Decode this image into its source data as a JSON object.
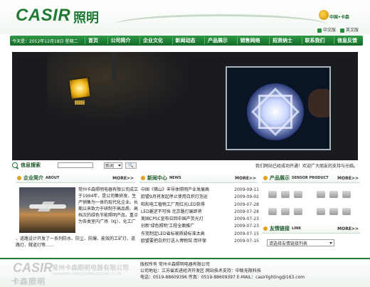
{
  "header": {
    "logo_en": "CASIR",
    "logo_cn": "照明",
    "brand_badge_text": "中国•卡森",
    "lang_cn": "中文版",
    "lang_en": "英文版"
  },
  "nav": {
    "date": "今天是：2012年12月18日 星期二",
    "items": [
      "首页",
      "公司简介",
      "企业文化",
      "新闻动态",
      "产品展示",
      "销售网络",
      "招贤纳士",
      "联系我们",
      "信息反馈"
    ]
  },
  "search": {
    "label": "信息搜索",
    "select_value": "新闻",
    "ticker": "我们网站已经成功开通！欢迎广大朋友的支持与光临。"
  },
  "about": {
    "title": "企业简介",
    "title_en": "ABOUT",
    "more": "MORE>>",
    "text_side": "常州卡森照明电器有限公司成立于1994年，是公司集研发、生产销售为一体的现代化企业。长期以来致力于研制于高品质、高档次的绿色节能照明产品，重点为各类室内广场（KJ）、化工厂",
    "text_bottom": "、道路设计开发了一系列防水、防尘、防爆、能效的工矿灯、道路灯、隧道灯等……"
  },
  "news": {
    "title": "新闻中心",
    "title_en": "NEWS",
    "more": "MORE>>",
    "items": [
      {
        "title": "中国《佛山》丰导体照明产业发展高",
        "date": "2009-09-11"
      },
      {
        "title": "欧盟9月将发起停止使用白炽灯泡运",
        "date": "2009-09-02"
      },
      {
        "title": "昭和电工植物工厂用红光LED获得",
        "date": "2009-07-28"
      },
      {
        "title": "LED邂逆不可挡 北京路灯展即将",
        "date": "2009-07-28"
      },
      {
        "title": "美国CPSC宣布召回中国产荧光灯",
        "date": "2009-07-23"
      },
      {
        "title": "创新'绿色照明'工程全面推广",
        "date": "2009-07-23"
      },
      {
        "title": "东莞制定LED省标被质疑标准太高",
        "date": "2009-07-15"
      },
      {
        "title": "欧盟要把白炽灯送入博物馆 用环保",
        "date": "2009-07-15"
      }
    ]
  },
  "products": {
    "title": "产品展示",
    "title_en": "SENSOR PRODUCT",
    "more": "MORE>>"
  },
  "links": {
    "title": "友情链接",
    "title_en": "LINK",
    "more": "MORE>>",
    "select_value": "请选择友情链接列表"
  },
  "footer": {
    "logo_en": "CASIR",
    "logo_cn": "卡森照明",
    "company_cn": "常州卡森照明电器有限公司",
    "company_en": "CHANGZHOU CASIR LIGHTING ELECTRIC CO.,LTD",
    "line1": "版权所有 常州卡森照明电器有限公司",
    "line2": "公司地址：江苏省武进经济开发区  网站技术支持：中联无限科技",
    "line3": "电话：0519-88609396 传真：0519-88609397 E-MAIL：casirlighting@163.com"
  },
  "colors": {
    "brand_green": "#1e7a34",
    "nav_green": "#2f9a44"
  }
}
